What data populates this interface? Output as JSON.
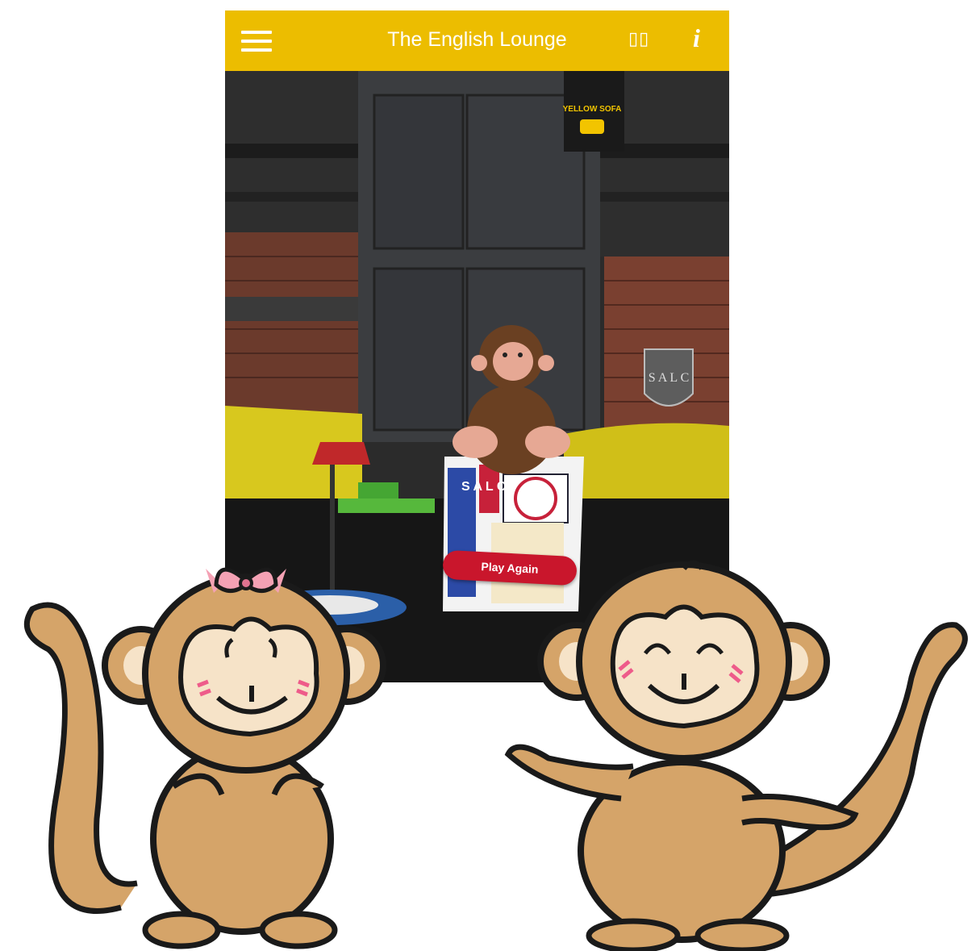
{
  "app": {
    "title": "The English Lounge",
    "icons": {
      "menu": "hamburger-menu-icon",
      "view": "glasses-icon",
      "info": "info-icon"
    },
    "info_glyph": "i"
  },
  "scene": {
    "sign_text": "YELLOW SOFA",
    "crest_text": "S A L C",
    "box_letters": "S A L C",
    "play_again_label": "Play Again"
  },
  "colors": {
    "appbar": "#ECBD00",
    "play_button": "#c9162c",
    "sofa": "#d8c81e",
    "monkey_tan": "#D5A469"
  }
}
